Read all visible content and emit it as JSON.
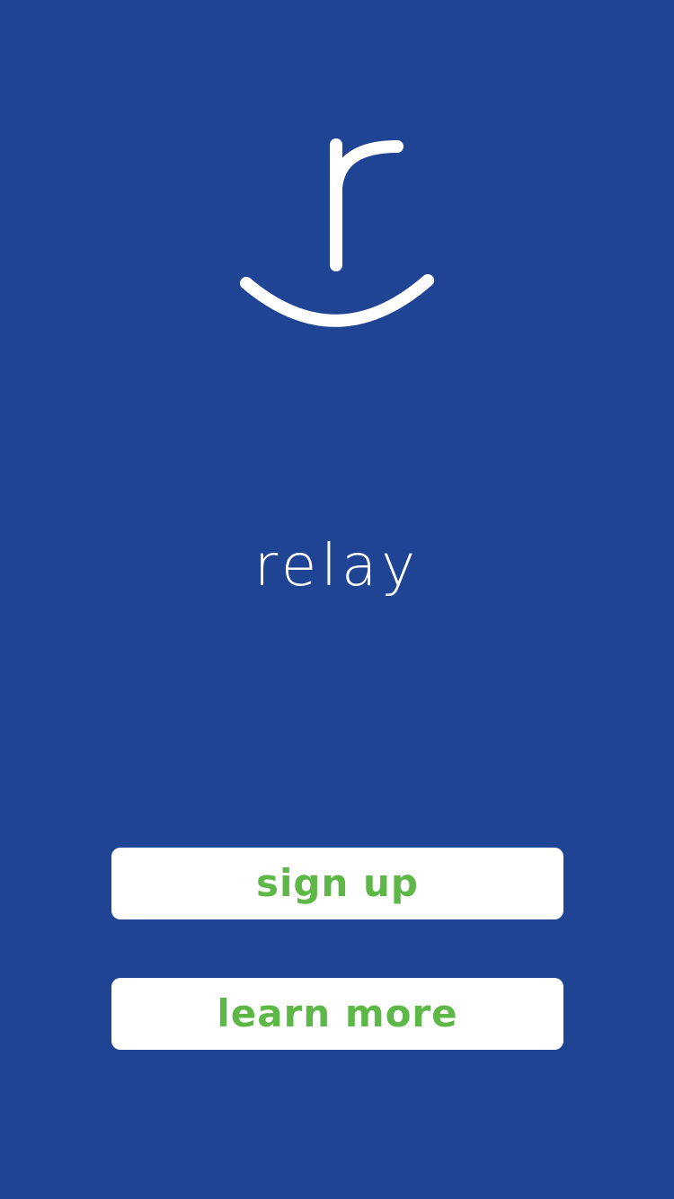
{
  "colors": {
    "background": "#1f4493",
    "button_background": "#ffffff",
    "button_text": "#5db848",
    "logo": "#ffffff"
  },
  "logo": {
    "icon": "relay-logo-icon"
  },
  "brand": {
    "name": "relay"
  },
  "actions": {
    "sign_up_label": "sign up",
    "learn_more_label": "learn more"
  }
}
